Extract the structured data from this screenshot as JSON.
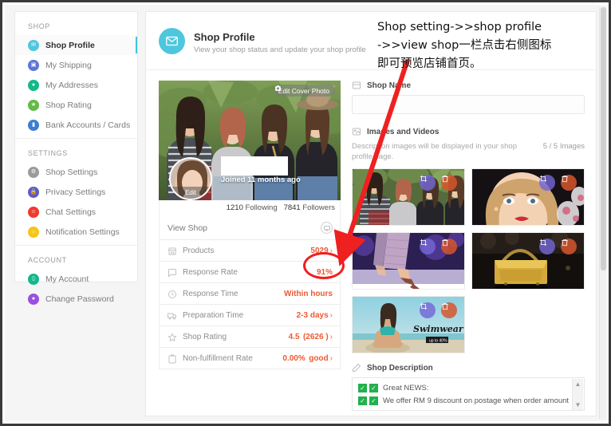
{
  "sidebar": {
    "groups": [
      {
        "title": "SHOP",
        "items": [
          {
            "label": "Shop Profile",
            "icon": "envelope-icon",
            "color": "#4ec7de",
            "active": true
          },
          {
            "label": "My Shipping",
            "icon": "truck-icon",
            "color": "#5b76d6",
            "active": false
          },
          {
            "label": "My Addresses",
            "icon": "location-pin-icon",
            "color": "#13b98a",
            "active": false
          },
          {
            "label": "Shop Rating",
            "icon": "star-icon",
            "color": "#62bb46",
            "active": false
          },
          {
            "label": "Bank Accounts / Cards",
            "icon": "card-icon",
            "color": "#3d7dd4",
            "active": false
          }
        ]
      },
      {
        "title": "SETTINGS",
        "items": [
          {
            "label": "Shop Settings",
            "icon": "gear-icon",
            "color": "#9b9b9b",
            "active": false
          },
          {
            "label": "Privacy Settings",
            "icon": "lock-icon",
            "color": "#6159c4",
            "active": false
          },
          {
            "label": "Chat Settings",
            "icon": "chat-icon",
            "color": "#ee3b2e",
            "active": false
          },
          {
            "label": "Notification Settings",
            "icon": "bell-icon",
            "color": "#f5c518",
            "active": false
          }
        ]
      },
      {
        "title": "ACCOUNT",
        "items": [
          {
            "label": "My Account",
            "icon": "id-card-icon",
            "color": "#10b98a",
            "active": false
          },
          {
            "label": "Change Password",
            "icon": "key-icon",
            "color": "#9b4fe0",
            "active": false
          }
        ]
      }
    ]
  },
  "header": {
    "title": "Shop Profile",
    "subtitle": "View your shop status and update your shop profile",
    "icon": "shop-profile-icon"
  },
  "profile_card": {
    "edit_cover_label": "Edit Cover Photo",
    "avatar_edit_label": "Edit",
    "joined": "Joined 11 months ago",
    "following_count": "1210",
    "following_label": "Following",
    "followers_count": "7841",
    "followers_label": "Followers",
    "view_shop_label": "View Shop",
    "view_shop_icon": "monitor-icon",
    "stats": [
      {
        "name": "Products",
        "icon": "store-icon",
        "value": "5029",
        "suffix": "",
        "chevron": true
      },
      {
        "name": "Response Rate",
        "icon": "message-icon",
        "value": "91%",
        "suffix": "",
        "chevron": false
      },
      {
        "name": "Response Time",
        "icon": "clock-icon",
        "value": "Within hours",
        "suffix": "",
        "chevron": false
      },
      {
        "name": "Preparation Time",
        "icon": "delivery-icon",
        "value": "2-3 days",
        "suffix": "",
        "chevron": true
      },
      {
        "name": "Shop Rating",
        "icon": "star-outline-icon",
        "value": "4.5",
        "suffix": "(2626 )",
        "chevron": true
      },
      {
        "name": "Non-fulfillment Rate",
        "icon": "clipboard-icon",
        "value": "0.00%",
        "suffix": "good",
        "chevron": true
      }
    ]
  },
  "form": {
    "shop_name_label": "Shop Name",
    "shop_name_icon": "shop-icon",
    "shop_name_value": "",
    "shop_name_placeholder": "",
    "images_label": "Images and Videos",
    "images_icon": "image-icon",
    "images_desc": "Description images will be displayed in your shop profile page.",
    "images_count": "5 / 5 Images",
    "thumbnails": [
      {
        "alt": "four-women-outdoors",
        "crop_icon": "crop-icon",
        "delete_icon": "trash-icon"
      },
      {
        "alt": "blonde-woman-red-lips",
        "crop_icon": "crop-icon",
        "delete_icon": "trash-icon"
      },
      {
        "alt": "runway-heels",
        "crop_icon": "crop-icon",
        "delete_icon": "trash-icon"
      },
      {
        "alt": "gold-handbag",
        "crop_icon": "crop-icon",
        "delete_icon": "trash-icon"
      },
      {
        "alt": "swimwear-beach",
        "crop_icon": "crop-icon",
        "delete_icon": "trash-icon"
      }
    ],
    "description_label": "Shop Description",
    "description_icon": "pencil-icon",
    "description_lines": [
      "Great NEWS:",
      "We offer RM 9 discount on postage when order amount"
    ]
  },
  "annotation": {
    "line1": "Shop setting->>shop profile",
    "line2": "->>view shop一栏点击右侧图标",
    "line3": "即可预览店铺首页。",
    "arrow_color": "#ef2020",
    "highlight_color": "#ef1f1f"
  }
}
